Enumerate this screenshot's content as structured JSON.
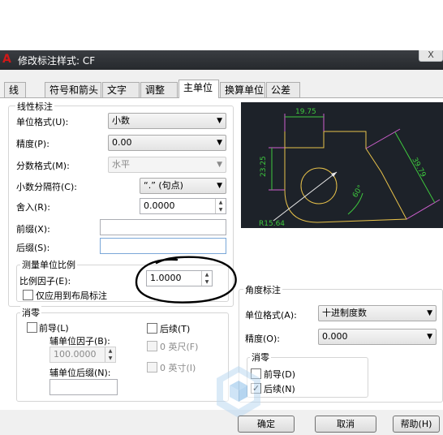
{
  "window": {
    "title": "修改标注样式: CF",
    "close_label": "X"
  },
  "tabs": [
    {
      "label": "线"
    },
    {
      "label": "符号和箭头"
    },
    {
      "label": "文字"
    },
    {
      "label": "调整"
    },
    {
      "label": "主单位"
    },
    {
      "label": "换算单位"
    },
    {
      "label": "公差"
    }
  ],
  "linear": {
    "group_label": "线性标注",
    "unit_format": {
      "label": "单位格式(U):",
      "value": "小数"
    },
    "precision": {
      "label": "精度(P):",
      "value": "0.00"
    },
    "fraction_format": {
      "label": "分数格式(M):",
      "value": "水平"
    },
    "decimal_separator": {
      "label": "小数分隔符(C):",
      "value": "“.” (句点)"
    },
    "round_off": {
      "label": "舍入(R):",
      "value": "0.0000"
    },
    "prefix": {
      "label": "前缀(X):",
      "value": ""
    },
    "suffix": {
      "label": "后缀(S):",
      "value": ""
    }
  },
  "scale": {
    "group_label": "测量单位比例",
    "factor_label": "比例因子(E):",
    "factor_value": "1.0000",
    "layout_only_label": "仅应用到布局标注"
  },
  "zero_suppression": {
    "group_label": "消零",
    "leading_label": "前导(L)",
    "trailing_label": "后续(T)",
    "sub_factor_label": "辅单位因子(B):",
    "sub_factor_value": "100.0000",
    "feet_label": "0 英尺(F)",
    "sub_suffix_label": "辅单位后缀(N):",
    "inches_label": "0 英寸(I)"
  },
  "angular": {
    "group_label": "角度标注",
    "unit_format": {
      "label": "单位格式(A):",
      "value": "十进制度数"
    },
    "precision": {
      "label": "精度(O):",
      "value": "0.000"
    },
    "zero_group_label": "消零",
    "leading_label": "前导(D)",
    "trailing_label": "后续(N)",
    "trailing_checked": true
  },
  "preview": {
    "dim_top": "19.75",
    "dim_left": "23.25",
    "dim_right": "39.79",
    "dim_angle": "60°",
    "dim_radius": "R15.64",
    "colors": {
      "background": "#1d2229",
      "geometry": "#e8c24a",
      "dimension": "#3ec83e",
      "text": "#3ec83e",
      "extension": "#d060d0",
      "leader": "#e8e8e8"
    }
  },
  "buttons": {
    "ok": "确定",
    "cancel": "取消",
    "help": "帮助(H)"
  },
  "annotation": {
    "color": "#000000"
  }
}
